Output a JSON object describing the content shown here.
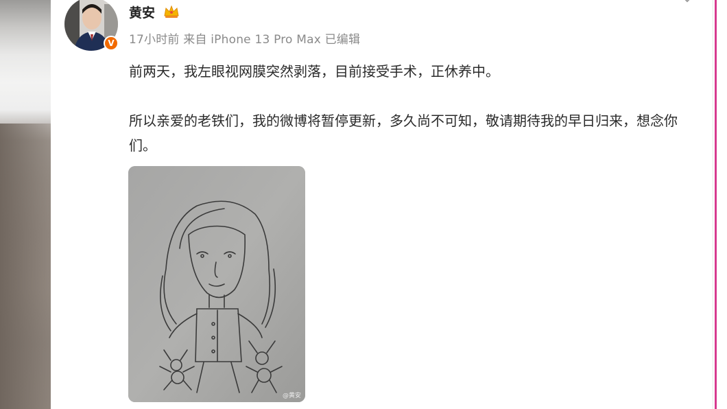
{
  "post": {
    "author_name": "黄安",
    "verified_badge": "V",
    "time": "17小时前",
    "source": "来自 iPhone 13 Pro Max",
    "edited": "已编辑",
    "paragraph_1": "前两天，我左眼视网膜突然剥落，目前接受手术，正休养中。",
    "paragraph_2": "所以亲爱的老铁们，我的微博将暂停更新，多久尚不可知，敬请期待我的早日归来，想念你们。",
    "image_watermark": "@黄安"
  },
  "colors": {
    "accent_magenta": "#d63a8f",
    "badge_orange": "#f26a00",
    "meta_gray": "#8a8a8a"
  },
  "icons": {
    "crown": "crown-icon",
    "more": "chevron-down-icon",
    "verified": "verified-badge-icon"
  }
}
